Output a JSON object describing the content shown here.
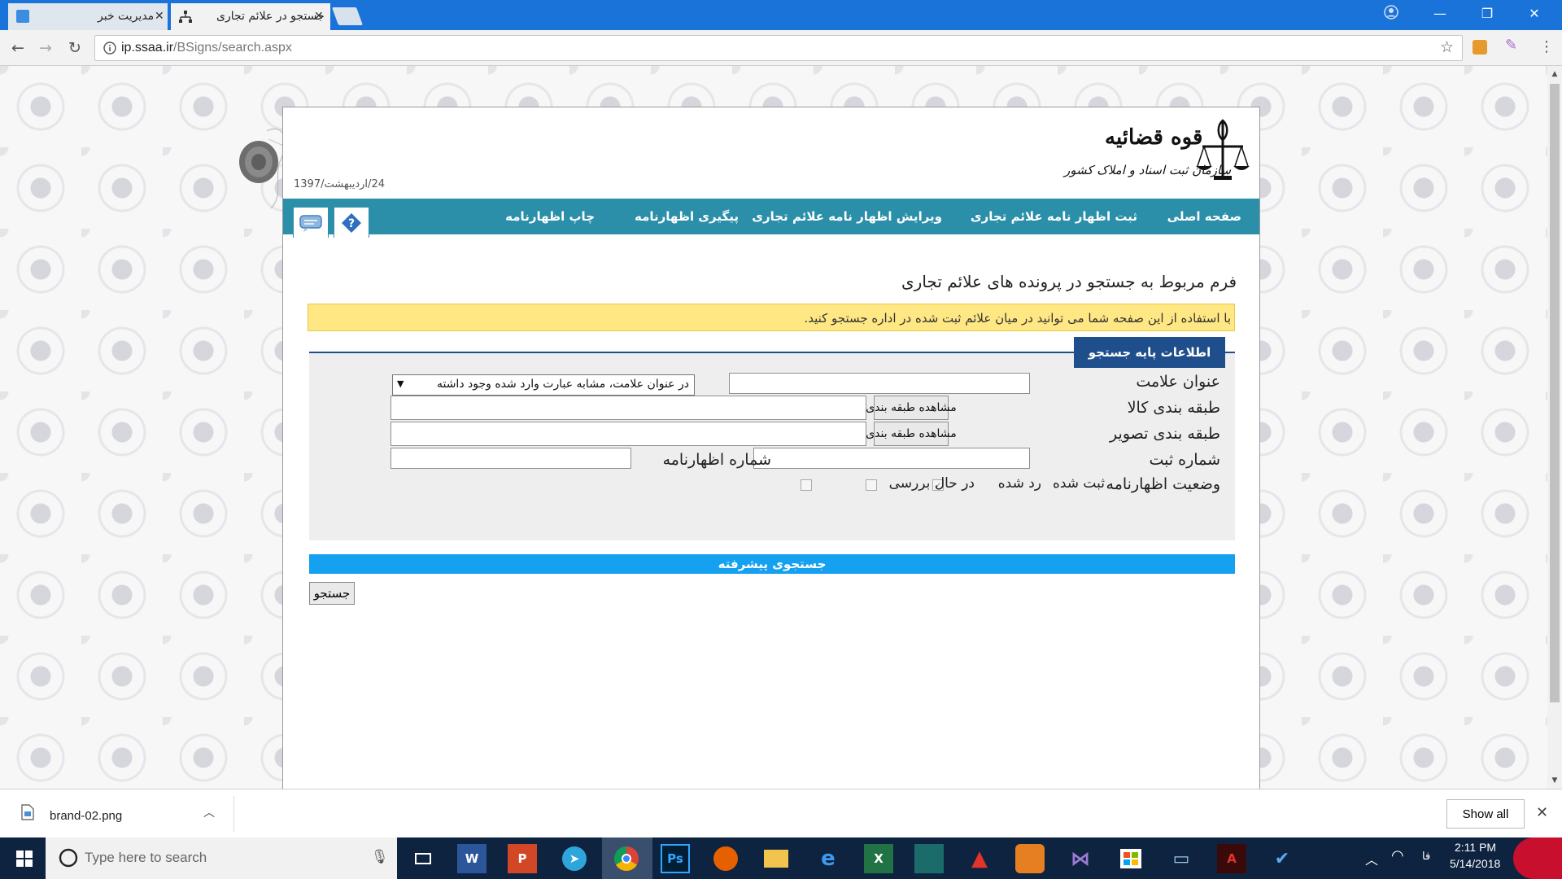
{
  "browser": {
    "tabs": [
      {
        "title": "مدیریت خبر",
        "active": false
      },
      {
        "title": "جستجو در علائم تجاری",
        "active": true
      }
    ],
    "url_host": "ip.ssaa.ir",
    "url_path": "/BSigns/search.aspx"
  },
  "header": {
    "date": "24/اردیبهشت/1397",
    "logo_line1": "قوه قضائیه",
    "logo_line2": "سازمان ثبت اسناد و املاک کشور"
  },
  "menu": {
    "items": [
      "صفحه اصلی",
      "ثبت اظهار نامه علائم تجاری",
      "ویرایش اظهار نامه علائم تجاری",
      "پیگیری اظهارنامه",
      "چاپ اظهارنامه"
    ],
    "icons": [
      "help-icon",
      "chat-icon"
    ]
  },
  "form": {
    "title": "فرم مربوط به جستجو در پرونده های علائم تجاری",
    "notice": "با استفاده از این صفحه شما می توانید در میان علائم ثبت شده در اداره جستجو کنید.",
    "panel_title": "اطلاعات پایه جستجو",
    "labels": {
      "trademark_title": "عنوان علامت",
      "goods_class": "طبقه بندی کالا",
      "image_class": "طبقه بندی تصویر",
      "registration_number": "شماره ثبت",
      "declaration_number": "شماره اظهارنامه",
      "declaration_status": "وضعیت اظهارنامه"
    },
    "match_select": "در عنوان علامت، مشابه عبارت وارد شده وجود داشته",
    "view_class_button": "مشاهده طبقه بندی",
    "status_options": [
      {
        "label": "ثبت شده",
        "checked": true
      },
      {
        "label": "رد شده",
        "checked": false
      },
      {
        "label": "در حال بررسی",
        "checked": false
      }
    ],
    "advanced_search": "جستجوی پیشرفته",
    "search_button": "جستجو"
  },
  "downloads": {
    "file": "brand-02.png",
    "show_all": "Show all"
  },
  "taskbar": {
    "search_placeholder": "Type here to search",
    "lang": "فا",
    "time": "2:11 PM",
    "date": "5/14/2018",
    "apps": [
      "task-view",
      "word",
      "powerpoint",
      "telegram",
      "chrome",
      "photoshop",
      "firefox",
      "file-explorer",
      "edge",
      "excel",
      "app",
      "acrobat",
      "app",
      "visual-studio",
      "store",
      "app",
      "acrobat-reader",
      "app"
    ]
  },
  "colors": {
    "titlebar": "#1a73d9",
    "menu_bar": "#2b8fa9",
    "panel_tab": "#1f4e8c",
    "notice_bg": "#ffe784",
    "advanced_bar": "#15a0f0",
    "taskbar": "#0e233f"
  }
}
